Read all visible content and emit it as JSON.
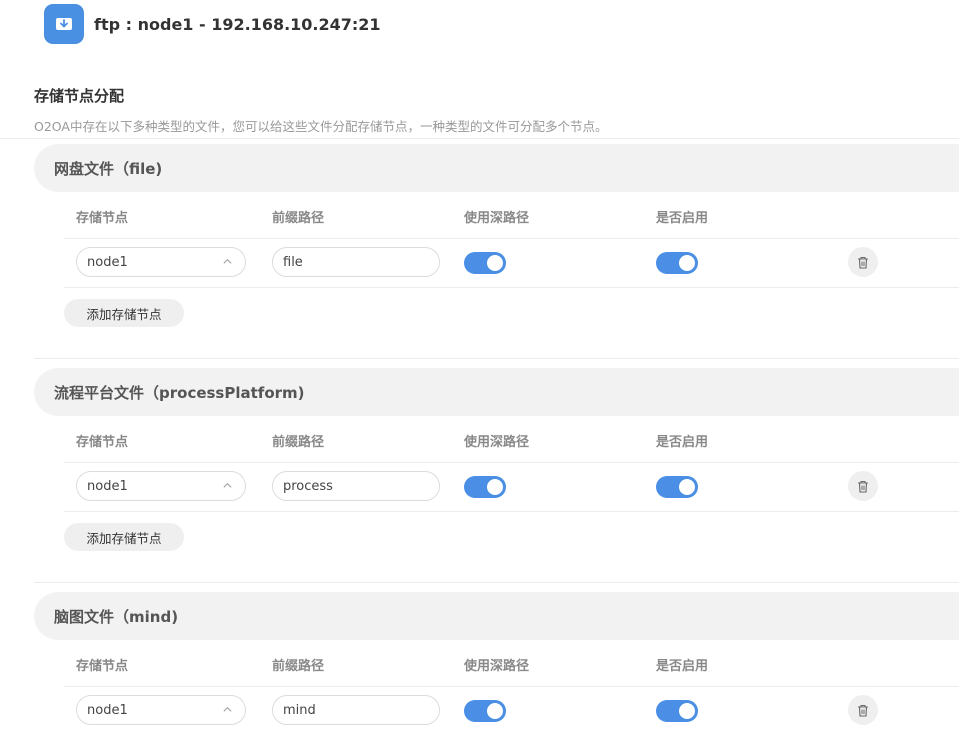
{
  "header": {
    "title": "ftp : node1 - 192.168.10.247:21",
    "icon": "download-icon",
    "accent": "#4a90e2"
  },
  "section": {
    "title": "存储节点分配",
    "description": "O2OA中存在以下多种类型的文件，您可以给这些文件分配存储节点，一种类型的文件可分配多个节点。"
  },
  "columns": {
    "node": "存储节点",
    "prefix": "前缀路径",
    "deep": "使用深路径",
    "enabled": "是否启用"
  },
  "add_label": "添加存储节点",
  "toggle_color": "#4a8ee6",
  "groups": [
    {
      "title": "网盘文件（file)",
      "rows": [
        {
          "node": "node1",
          "prefix": "file",
          "deep": true,
          "enabled": true
        }
      ]
    },
    {
      "title": "流程平台文件（processPlatform)",
      "rows": [
        {
          "node": "node1",
          "prefix": "process",
          "deep": true,
          "enabled": true
        }
      ]
    },
    {
      "title": "脑图文件（mind)",
      "rows": [
        {
          "node": "node1",
          "prefix": "mind",
          "deep": true,
          "enabled": true
        }
      ]
    }
  ]
}
